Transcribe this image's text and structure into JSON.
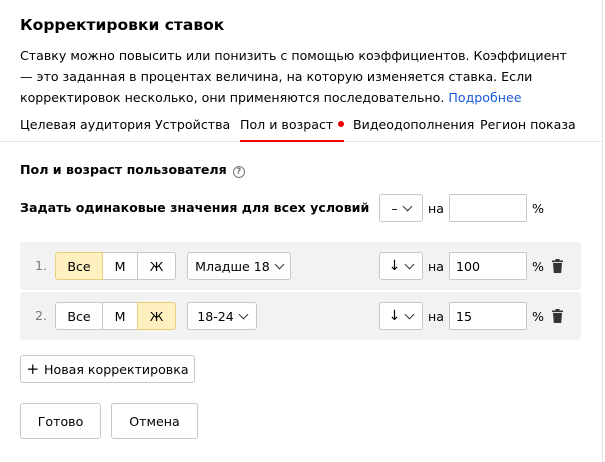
{
  "dialog": {
    "title": "Корректировки ставок",
    "description": "Ставку можно повысить или понизить с помощью коэффициентов. Коэффициент — это заданная в процентах величина, на которую изменяется ставка. Если корректировок несколько, они применяются последовательно.",
    "more_link": "Подробнее"
  },
  "tabs": [
    {
      "label": "Целевая аудитория",
      "active": false
    },
    {
      "label": "Устройства",
      "active": false
    },
    {
      "label": "Пол и возраст",
      "active": true,
      "has_dot": true
    },
    {
      "label": "Видеодополнения",
      "active": false
    },
    {
      "label": "Регион показа",
      "active": false
    }
  ],
  "section": {
    "title": "Пол и возраст пользователя",
    "help_icon": "question-circle-icon",
    "same_values_label": "Задать одинаковые значения для всех условий",
    "same_direction": "–",
    "on_label": "на",
    "same_value": "",
    "percent": "%"
  },
  "rows": [
    {
      "number": "1.",
      "gender_options": [
        "Все",
        "М",
        "Ж"
      ],
      "gender_selected": "Все",
      "age": "Младше 18",
      "direction": "↓",
      "on_label": "на",
      "value": "100",
      "percent": "%"
    },
    {
      "number": "2.",
      "gender_options": [
        "Все",
        "М",
        "Ж"
      ],
      "gender_selected": "Ж",
      "age": "18-24",
      "direction": "↓",
      "on_label": "на",
      "value": "15",
      "percent": "%"
    }
  ],
  "add_button": {
    "plus": "+",
    "label": "Новая корректировка"
  },
  "footer": {
    "done": "Готово",
    "cancel": "Отмена"
  },
  "colors": {
    "accent_red": "#f00000",
    "link": "#1a5ad9",
    "selected_bg": "#fff0c0",
    "row_bg": "#f2f2f2"
  }
}
